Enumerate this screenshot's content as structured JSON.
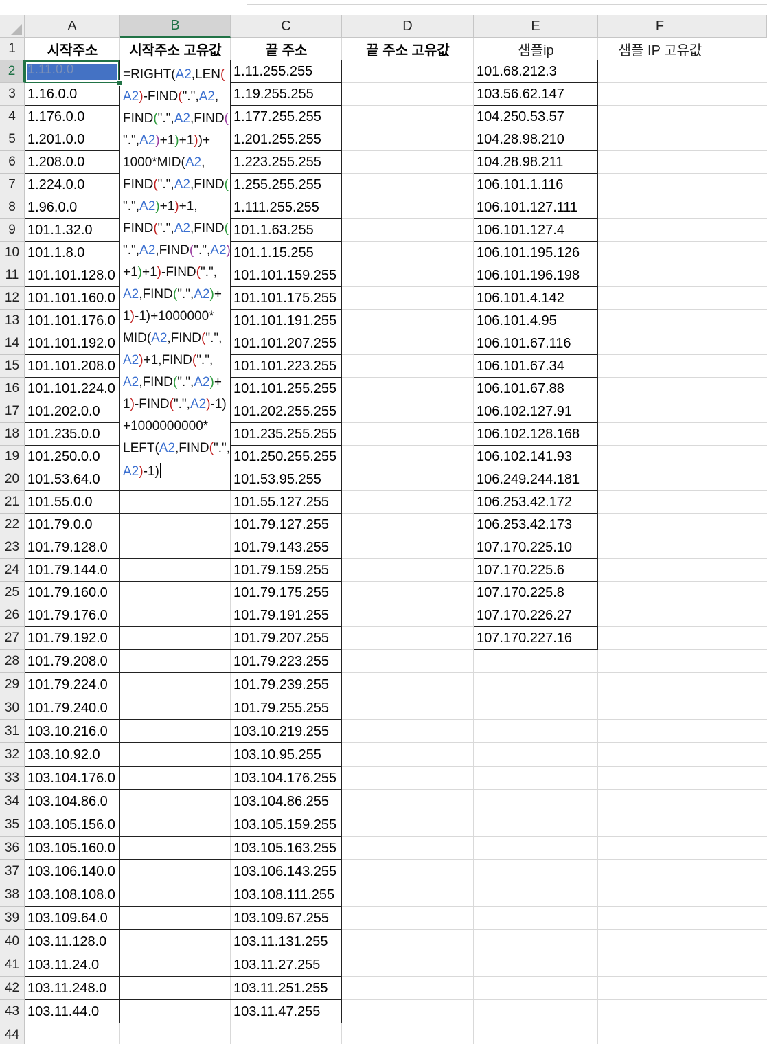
{
  "columns": [
    "A",
    "B",
    "C",
    "D",
    "E",
    "F"
  ],
  "selected_column": "B",
  "active_cell": "A2",
  "headers": {
    "A": "시작주소",
    "B": "시작주소 고유값",
    "C": "끝 주소",
    "D": "끝 주소 고유값",
    "E": "샘플ip",
    "F": "샘플 IP 고유값"
  },
  "col_a": [
    "1.11.0.0",
    "1.16.0.0",
    "1.176.0.0",
    "1.201.0.0",
    "1.208.0.0",
    "1.224.0.0",
    "1.96.0.0",
    "101.1.32.0",
    "101.1.8.0",
    "101.101.128.0",
    "101.101.160.0",
    "101.101.176.0",
    "101.101.192.0",
    "101.101.208.0",
    "101.101.224.0",
    "101.202.0.0",
    "101.235.0.0",
    "101.250.0.0",
    "101.53.64.0",
    "101.55.0.0",
    "101.79.0.0",
    "101.79.128.0",
    "101.79.144.0",
    "101.79.160.0",
    "101.79.176.0",
    "101.79.192.0",
    "101.79.208.0",
    "101.79.224.0",
    "101.79.240.0",
    "103.10.216.0",
    "103.10.92.0",
    "103.104.176.0",
    "103.104.86.0",
    "103.105.156.0",
    "103.105.160.0",
    "103.106.140.0",
    "103.108.108.0",
    "103.109.64.0",
    "103.11.128.0",
    "103.11.24.0",
    "103.11.248.0",
    "103.11.44.0"
  ],
  "col_c": [
    "1.11.255.255",
    "1.19.255.255",
    "1.177.255.255",
    "1.201.255.255",
    "1.223.255.255",
    "1.255.255.255",
    "1.111.255.255",
    "101.1.63.255",
    "101.1.15.255",
    "101.101.159.255",
    "101.101.175.255",
    "101.101.191.255",
    "101.101.207.255",
    "101.101.223.255",
    "101.101.255.255",
    "101.202.255.255",
    "101.235.255.255",
    "101.250.255.255",
    "101.53.95.255",
    "101.55.127.255",
    "101.79.127.255",
    "101.79.143.255",
    "101.79.159.255",
    "101.79.175.255",
    "101.79.191.255",
    "101.79.207.255",
    "101.79.223.255",
    "101.79.239.255",
    "101.79.255.255",
    "103.10.219.255",
    "103.10.95.255",
    "103.104.176.255",
    "103.104.86.255",
    "103.105.159.255",
    "103.105.163.255",
    "103.106.143.255",
    "103.108.111.255",
    "103.109.67.255",
    "103.11.131.255",
    "103.11.27.255",
    "103.11.251.255",
    "103.11.47.255"
  ],
  "col_e": [
    "101.68.212.3",
    "103.56.62.147",
    "104.250.53.57",
    "104.28.98.210",
    "104.28.98.211",
    "106.101.1.116",
    "106.101.127.111",
    "106.101.127.4",
    "106.101.195.126",
    "106.101.196.198",
    "106.101.4.142",
    "106.101.4.95",
    "106.101.67.116",
    "106.101.67.34",
    "106.101.67.88",
    "106.102.127.91",
    "106.102.128.168",
    "106.102.141.93",
    "106.249.244.181",
    "106.253.42.172",
    "106.253.42.173",
    "107.170.225.10",
    "107.170.225.6",
    "107.170.225.8",
    "107.170.226.27",
    "107.170.227.16"
  ],
  "formula_lines": [
    "=RIGHT(A2,LEN(",
    "A2)-FIND(\".\",A2,",
    "FIND(\".\",A2,FIND(",
    "\".\",A2)+1)+1))+",
    "1000*MID(A2,",
    "FIND(\".\",A2,FIND(",
    "\".\",A2)+1)+1,",
    "FIND(\".\",A2,FIND(",
    "\".\",A2,FIND(\".\",A2)",
    "+1)+1)-FIND(\".\",",
    "A2,FIND(\".\",A2)+",
    "1)-1)+1000000*",
    "MID(A2,FIND(\".\",",
    "A2)+1,FIND(\".\",",
    "A2,FIND(\".\",A2)+",
    "1)-FIND(\".\",A2)-1)",
    "+1000000000*",
    "LEFT(A2,FIND(\".\",",
    "A2)-1)"
  ],
  "colors": {
    "selection_green": "#217346",
    "active_cell_fill": "#4472c4",
    "reference_blue": "#3a6fd0"
  }
}
